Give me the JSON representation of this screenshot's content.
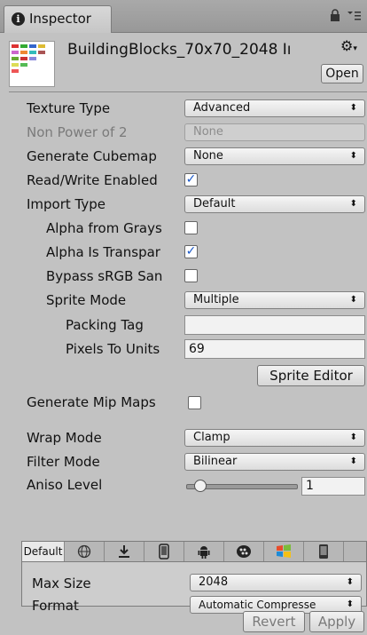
{
  "window": {
    "tab_title": "Inspector",
    "info_glyph": "i",
    "lock_icon": "lock-icon",
    "menu_icon": "menu-icon"
  },
  "header": {
    "asset_name": "BuildingBlocks_70x70_2048 Iı",
    "gear_icon": "gear-icon",
    "open_label": "Open"
  },
  "rows": {
    "texture_type": {
      "label": "Texture Type",
      "value": "Advanced"
    },
    "non_power_of_2": {
      "label": "Non Power of 2",
      "value": "None"
    },
    "generate_cubemap": {
      "label": "Generate Cubemap",
      "value": "None"
    },
    "read_write": {
      "label": "Read/Write Enabled",
      "checked": true
    },
    "import_type": {
      "label": "Import Type",
      "value": "Default"
    },
    "alpha_from_grays": {
      "label": "Alpha from Grays",
      "checked": false
    },
    "alpha_is_transparency": {
      "label": "Alpha Is Transpar",
      "checked": true
    },
    "bypass_srgb": {
      "label": "Bypass sRGB San",
      "checked": false
    },
    "sprite_mode": {
      "label": "Sprite Mode",
      "value": "Multiple"
    },
    "packing_tag": {
      "label": "Packing Tag",
      "value": ""
    },
    "pixels_to_units": {
      "label": "Pixels To Units",
      "value": "69"
    },
    "sprite_editor_label": "Sprite Editor",
    "generate_mip_maps": {
      "label": "Generate Mip Maps",
      "checked": false
    },
    "wrap_mode": {
      "label": "Wrap Mode",
      "value": "Clamp"
    },
    "filter_mode": {
      "label": "Filter Mode",
      "value": "Bilinear"
    },
    "aniso_level": {
      "label": "Aniso Level",
      "value": "1",
      "slider_fraction": 0.08
    }
  },
  "platforms": {
    "tabs": [
      {
        "label": "Default",
        "icon": "default-tab"
      },
      {
        "label": "",
        "icon": "web-globe-icon"
      },
      {
        "label": "",
        "icon": "standalone-download-icon"
      },
      {
        "label": "",
        "icon": "ios-phone-icon"
      },
      {
        "label": "",
        "icon": "android-icon"
      },
      {
        "label": "",
        "icon": "blackberry-icon"
      },
      {
        "label": "",
        "icon": "windows-store-icon"
      },
      {
        "label": "",
        "icon": "windows-phone-icon"
      }
    ],
    "max_size": {
      "label": "Max Size",
      "value": "2048"
    },
    "format": {
      "label": "Format",
      "value": "Automatic Compresse"
    }
  },
  "footer": {
    "revert_label": "Revert",
    "apply_label": "Apply"
  },
  "colors": {
    "panel_bg": "#c2c2c2",
    "check_blue": "#1a58c9"
  }
}
